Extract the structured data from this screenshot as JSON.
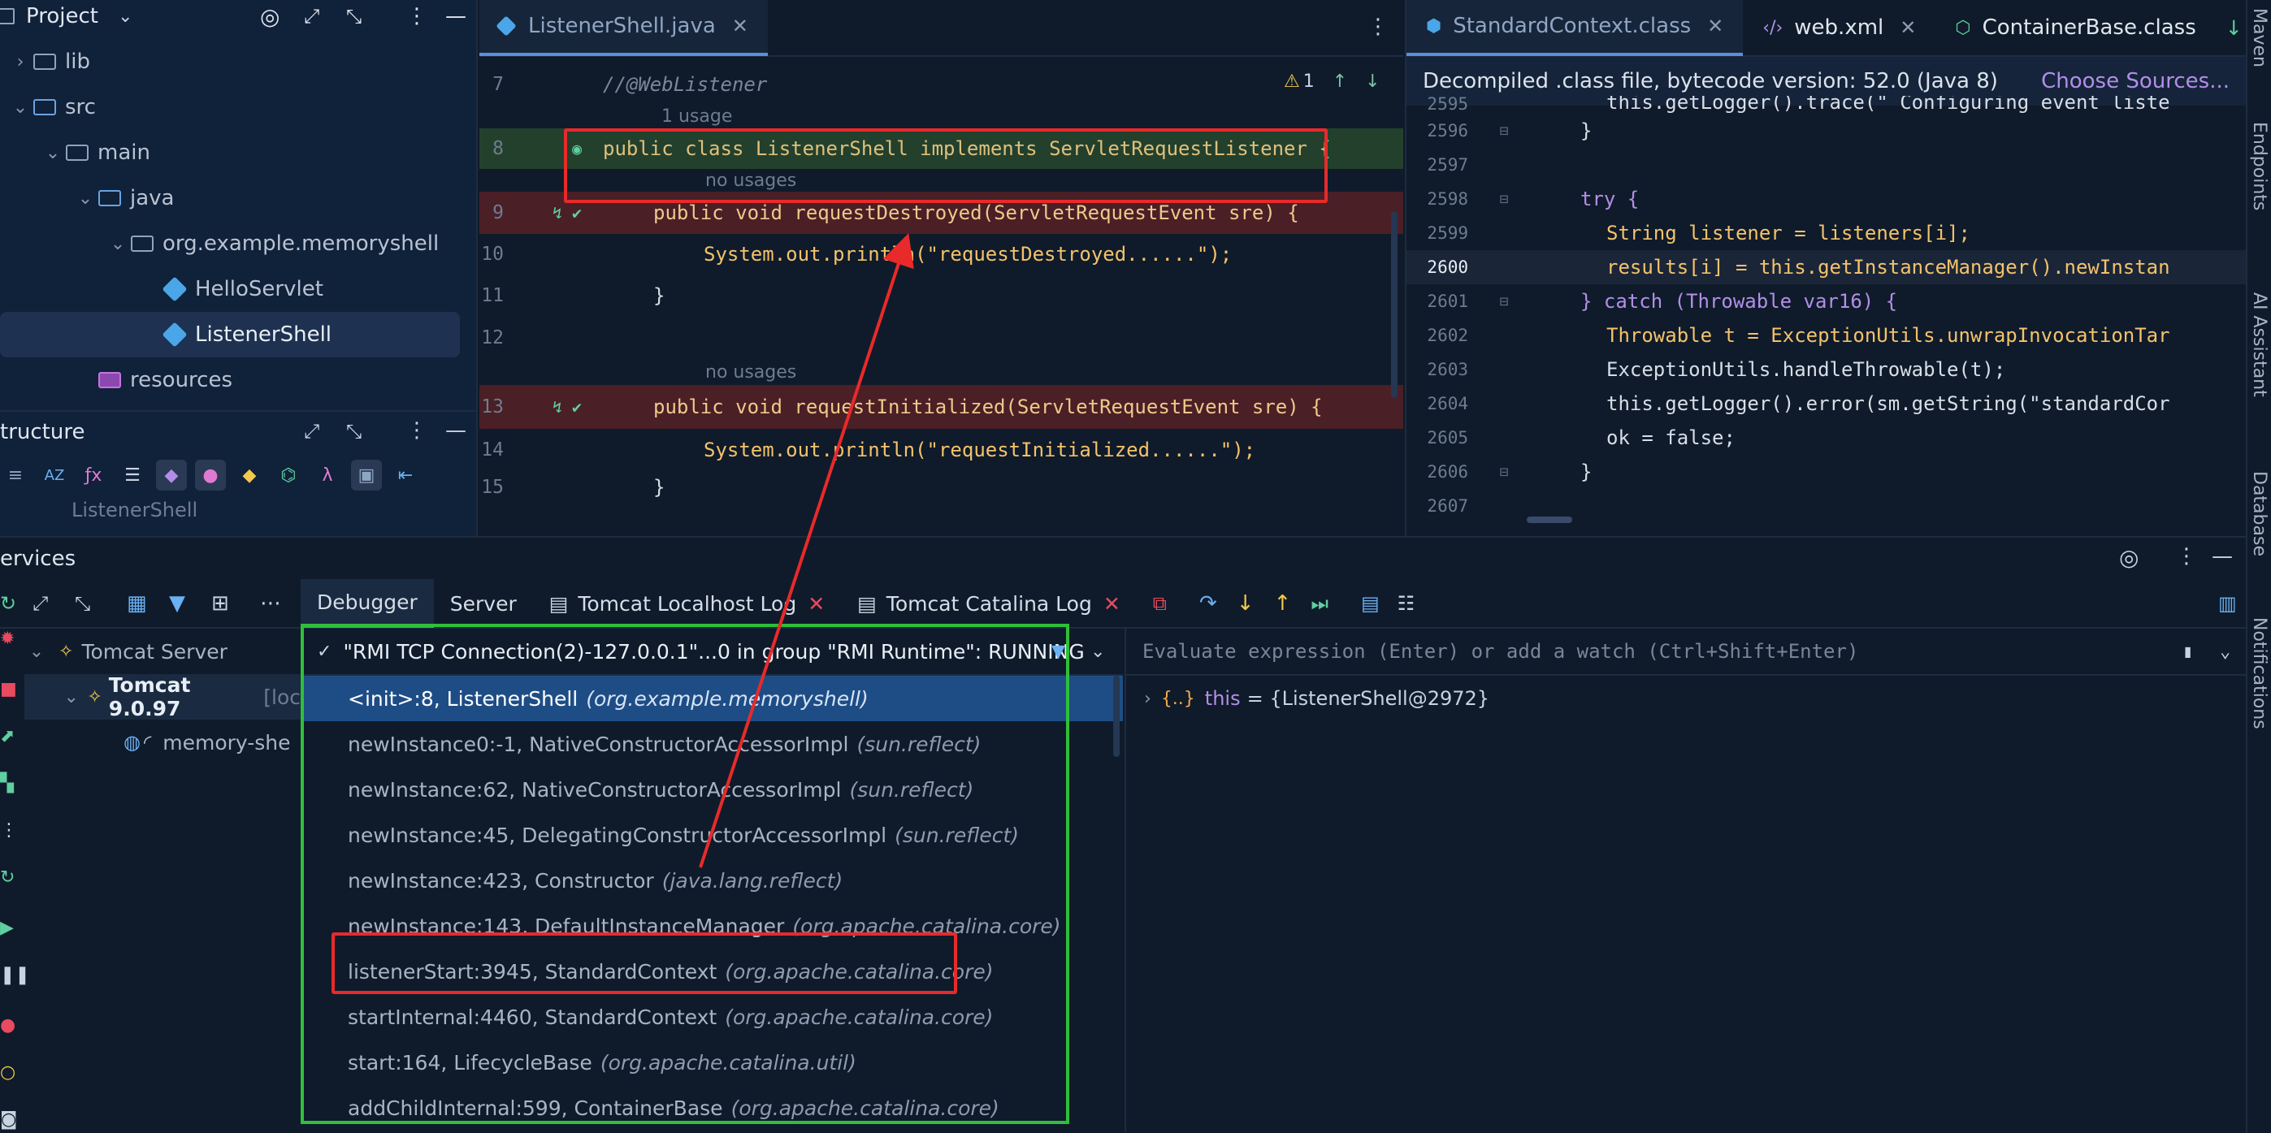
{
  "project_panel": {
    "title": "Project",
    "tree": [
      {
        "label": "lib",
        "depth": 1,
        "type": "folder"
      },
      {
        "label": "src",
        "depth": 1,
        "type": "src"
      },
      {
        "label": "main",
        "depth": 2,
        "type": "folder"
      },
      {
        "label": "java",
        "depth": 3,
        "type": "src"
      },
      {
        "label": "org.example.memoryshell",
        "depth": 4,
        "type": "package"
      },
      {
        "label": "HelloServlet",
        "depth": 5,
        "type": "class"
      },
      {
        "label": "ListenerShell",
        "depth": 5,
        "type": "class"
      },
      {
        "label": "resources",
        "depth": 3,
        "type": "res"
      }
    ]
  },
  "structure_panel": {
    "title": "tructure",
    "item": "ListenerShell"
  },
  "editor_left": {
    "tab": "ListenerShell.java",
    "warning_count": "1",
    "lines": [
      {
        "num": "7",
        "code": "//@WebListener"
      },
      {
        "hint": "1 usage"
      },
      {
        "num": "8",
        "code": "public class ListenerShell implements ServletRequestListener {"
      },
      {
        "hint": "no usages"
      },
      {
        "num": "9",
        "code": "public void requestDestroyed(ServletRequestEvent sre) {"
      },
      {
        "num": "10",
        "code": "System.out.println(\"requestDestroyed......\");"
      },
      {
        "num": "11",
        "code": "}"
      },
      {
        "num": "12",
        "code": ""
      },
      {
        "hint": "no usages"
      },
      {
        "num": "13",
        "code": "public void requestInitialized(ServletRequestEvent sre) {"
      },
      {
        "num": "14",
        "code": "System.out.println(\"requestInitialized......\");"
      },
      {
        "num": "15",
        "code": "}"
      }
    ]
  },
  "editor_right": {
    "tabs": [
      "StandardContext.class",
      "web.xml",
      "ContainerBase.class"
    ],
    "banner": "Decompiled .class file, bytecode version: 52.0 (Java 8)",
    "choose_sources": "Choose Sources...",
    "lines": [
      {
        "num": "2595",
        "code": "this.getLogger().trace(\" Configuring event liste"
      },
      {
        "num": "2596",
        "code": "}"
      },
      {
        "num": "2597",
        "code": ""
      },
      {
        "num": "2598",
        "code": "try {"
      },
      {
        "num": "2599",
        "code": "String listener = listeners[i];"
      },
      {
        "num": "2600",
        "code": "results[i] = this.getInstanceManager().newInstan"
      },
      {
        "num": "2601",
        "code": "} catch (Throwable var16) {"
      },
      {
        "num": "2602",
        "code": "Throwable t = ExceptionUtils.unwrapInvocationTar"
      },
      {
        "num": "2603",
        "code": "ExceptionUtils.handleThrowable(t);"
      },
      {
        "num": "2604",
        "code": "this.getLogger().error(sm.getString(\"standardCor"
      },
      {
        "num": "2605",
        "code": "ok = false;"
      },
      {
        "num": "2606",
        "code": "}"
      },
      {
        "num": "2607",
        "code": ""
      }
    ]
  },
  "right_strip": [
    "Maven",
    "Endpoints",
    "AI Assistant",
    "Database",
    "Notifications"
  ],
  "services": {
    "title": "ervices",
    "tabs": [
      "Debugger",
      "Server",
      "Tomcat Localhost Log",
      "Tomcat Catalina Log"
    ],
    "tree": [
      {
        "label": "Tomcat Server"
      },
      {
        "label": "Tomcat 9.0.97",
        "suffix": "[loc"
      },
      {
        "label": "memory-she"
      }
    ],
    "thread": "\"RMI TCP Connection(2)-127.0.0.1\"...0 in group \"RMI Runtime\": RUNNING",
    "frames": [
      {
        "method": "<init>:8, ListenerShell",
        "pkg": "(org.example.memoryshell)"
      },
      {
        "method": "newInstance0:-1, NativeConstructorAccessorImpl",
        "pkg": "(sun.reflect)"
      },
      {
        "method": "newInstance:62, NativeConstructorAccessorImpl",
        "pkg": "(sun.reflect)"
      },
      {
        "method": "newInstance:45, DelegatingConstructorAccessorImpl",
        "pkg": "(sun.reflect)"
      },
      {
        "method": "newInstance:423, Constructor",
        "pkg": "(java.lang.reflect)"
      },
      {
        "method": "newInstance:143, DefaultInstanceManager",
        "pkg": "(org.apache.catalina.core)"
      },
      {
        "method": "listenerStart:3945, StandardContext",
        "pkg": "(org.apache.catalina.core)"
      },
      {
        "method": "startInternal:4460, StandardContext",
        "pkg": "(org.apache.catalina.core)"
      },
      {
        "method": "start:164, LifecycleBase",
        "pkg": "(org.apache.catalina.util)"
      },
      {
        "method": "addChildInternal:599, ContainerBase",
        "pkg": "(org.apache.catalina.core)"
      }
    ],
    "watch_placeholder": "Evaluate expression (Enter) or add a watch (Ctrl+Shift+Enter)",
    "variable": {
      "name": "this",
      "value": "= {ListenerShell@2972}"
    }
  },
  "colors": {
    "annotation_red": "#e82a2a",
    "annotation_green": "#2fbf3a",
    "selection": "#1e4d86"
  }
}
